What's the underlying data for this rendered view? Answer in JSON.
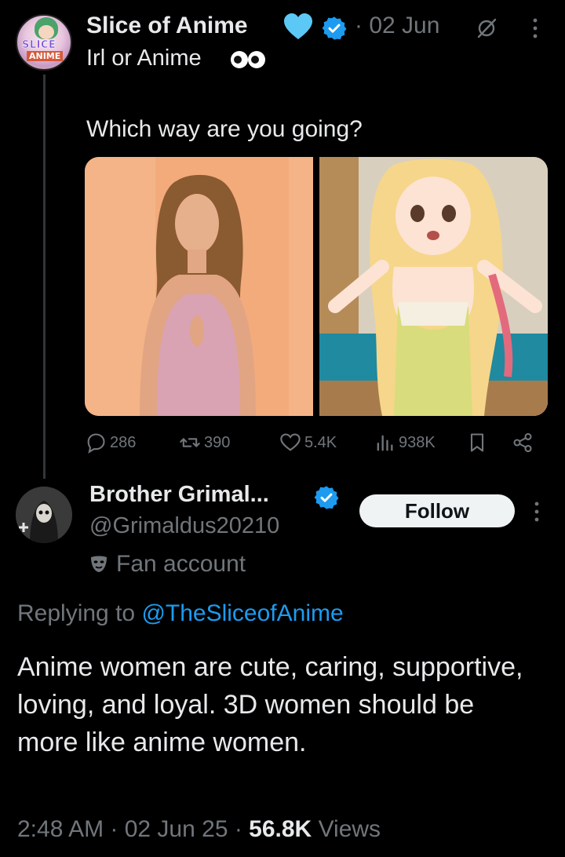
{
  "tweet": {
    "author_name": "Slice of Anime",
    "date": "· 02 Jun",
    "subtitle": "Irl or Anime",
    "text": "Which way are you going?",
    "avatar_text_top": "SLICE",
    "avatar_text_bottom": "ANIME",
    "stats": {
      "replies": "286",
      "retweets": "390",
      "likes": "5.4K",
      "views": "938K"
    }
  },
  "reply": {
    "author_name": "Brother Grimal...",
    "handle": "@Grimaldus20210",
    "follow_label": "Follow",
    "badge_label": "Fan account",
    "replying_prefix": "Replying to ",
    "replying_mention": "@TheSliceofAnime",
    "body": "Anime women are cute, caring, supportive, loving, and loyal. 3D women should be more like anime women.",
    "time": "2:48 AM · 02 Jun 25 · ",
    "views_count": "56.8K",
    "views_label": " Views"
  },
  "icons": {
    "heart": "blue-heart-icon",
    "verified": "verified-badge-icon",
    "grok": "grok-icon",
    "more": "more-vertical-icon",
    "eyes": "eyes-icon",
    "reply": "reply-icon",
    "retweet": "retweet-icon",
    "like": "like-icon",
    "views": "views-icon",
    "bookmark": "bookmark-icon",
    "share": "share-icon",
    "mask": "theater-mask-icon"
  },
  "colors": {
    "background": "#000000",
    "text_primary": "#e7e9ea",
    "text_secondary": "#71767b",
    "accent": "#1d9bf0",
    "heart": "#5cc8f5"
  }
}
